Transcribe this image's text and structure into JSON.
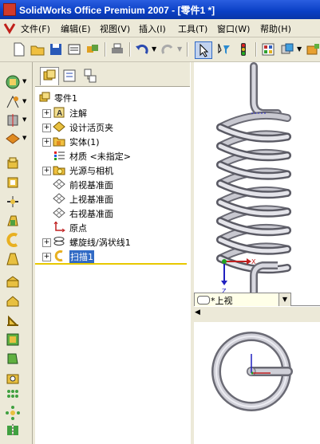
{
  "window": {
    "title": "SolidWorks Office Premium 2007 - [零件1 *]"
  },
  "menu": [
    "文件(F)",
    "编辑(E)",
    "视图(V)",
    "插入(I)",
    "工具(T)",
    "窗口(W)",
    "帮助(H)"
  ],
  "tree": {
    "root": "零件1",
    "items": [
      {
        "label": "注解",
        "icon": "annotation-icon",
        "expand": true
      },
      {
        "label": "设计活页夹",
        "icon": "design-binder-icon",
        "expand": true
      },
      {
        "label": "实体(1)",
        "icon": "solid-bodies-icon",
        "expand": true
      },
      {
        "label": "材质 <未指定>",
        "icon": "material-icon",
        "expand": false
      },
      {
        "label": "光源与相机",
        "icon": "lights-cameras-icon",
        "expand": true
      },
      {
        "label": "前视基准面",
        "icon": "plane-icon",
        "expand": false
      },
      {
        "label": "上视基准面",
        "icon": "plane-icon",
        "expand": false
      },
      {
        "label": "右视基准面",
        "icon": "plane-icon",
        "expand": false
      },
      {
        "label": "原点",
        "icon": "origin-icon",
        "expand": false
      },
      {
        "label": "螺旋线/涡状线1",
        "icon": "helix-icon",
        "expand": true
      },
      {
        "label": "扫描1",
        "icon": "sweep-icon",
        "expand": true,
        "selected": true
      }
    ]
  },
  "view": {
    "orientation": "*上视"
  },
  "colors": {
    "titlebar": "#0a3fc4",
    "selection": "#316ac5",
    "spring": "#b8b8c0"
  }
}
